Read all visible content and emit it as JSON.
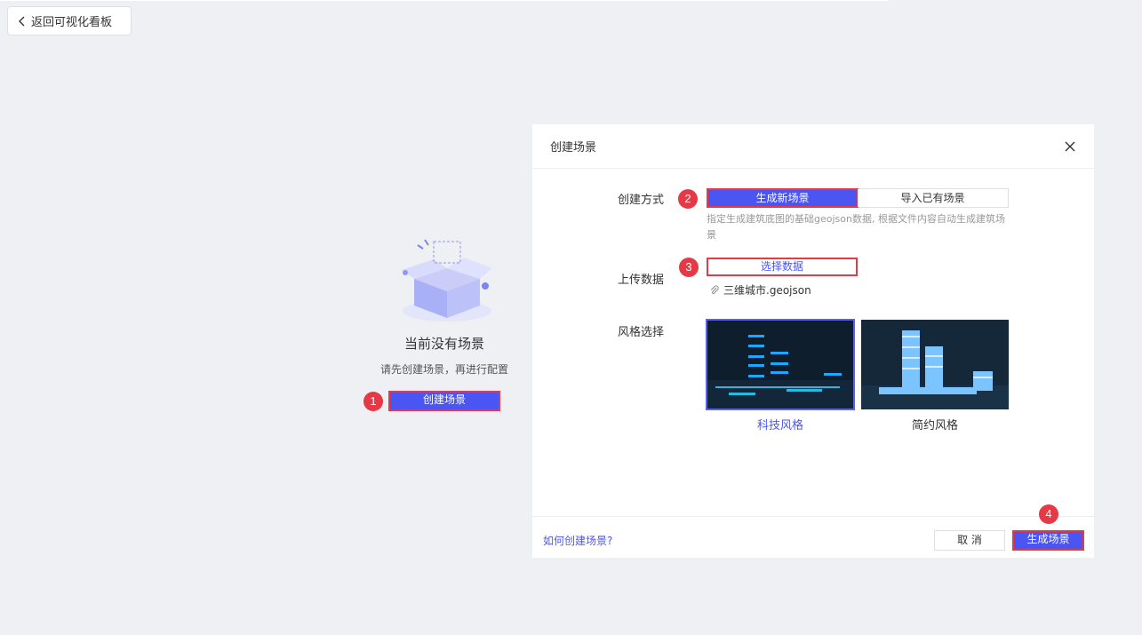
{
  "back": {
    "label": "返回可视化看板"
  },
  "empty": {
    "title": "当前没有场景",
    "subtitle": "请先创建场景，再进行配置",
    "create_button": "创建场景"
  },
  "badges": {
    "b1": "1",
    "b2": "2",
    "b3": "3",
    "b4": "4"
  },
  "dialog": {
    "title": "创建场景",
    "create_mode": {
      "label": "创建方式",
      "options": [
        "生成新场景",
        "导入已有场景"
      ],
      "selected": "生成新场景",
      "hint": "指定生成建筑底图的基础geojson数据, 根据文件内容自动生成建筑场景"
    },
    "upload": {
      "label": "上传数据",
      "button": "选择数据",
      "file_name": "三维城市.geojson"
    },
    "style": {
      "label": "风格选择",
      "options": [
        "科技风格",
        "简约风格"
      ],
      "selected": "科技风格"
    },
    "footer": {
      "help_link": "如何创建场景?",
      "cancel": "取 消",
      "generate": "生成场景"
    }
  },
  "colors": {
    "primary": "#4b56f2",
    "highlight": "#e63946",
    "background": "#eff0f4"
  }
}
